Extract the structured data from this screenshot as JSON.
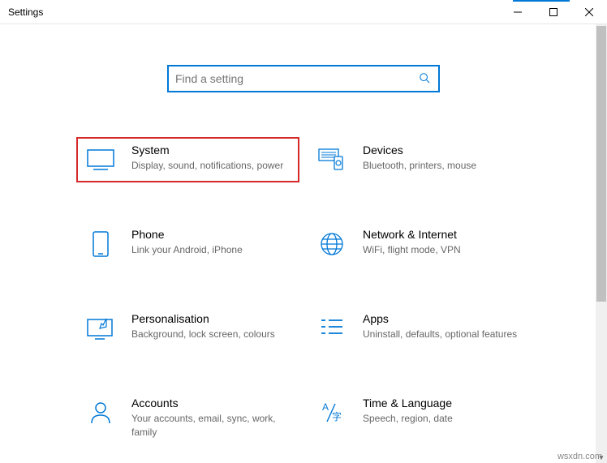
{
  "window": {
    "title": "Settings"
  },
  "search": {
    "placeholder": "Find a setting"
  },
  "categories": [
    {
      "id": "system",
      "title": "System",
      "sub": "Display, sound, notifications, power",
      "highlighted": true
    },
    {
      "id": "devices",
      "title": "Devices",
      "sub": "Bluetooth, printers, mouse"
    },
    {
      "id": "phone",
      "title": "Phone",
      "sub": "Link your Android, iPhone"
    },
    {
      "id": "network",
      "title": "Network & Internet",
      "sub": "WiFi, flight mode, VPN"
    },
    {
      "id": "personalisation",
      "title": "Personalisation",
      "sub": "Background, lock screen, colours"
    },
    {
      "id": "apps",
      "title": "Apps",
      "sub": "Uninstall, defaults, optional features"
    },
    {
      "id": "accounts",
      "title": "Accounts",
      "sub": "Your accounts, email, sync, work, family"
    },
    {
      "id": "time",
      "title": "Time & Language",
      "sub": "Speech, region, date"
    }
  ],
  "watermark": "wsxdn.com"
}
